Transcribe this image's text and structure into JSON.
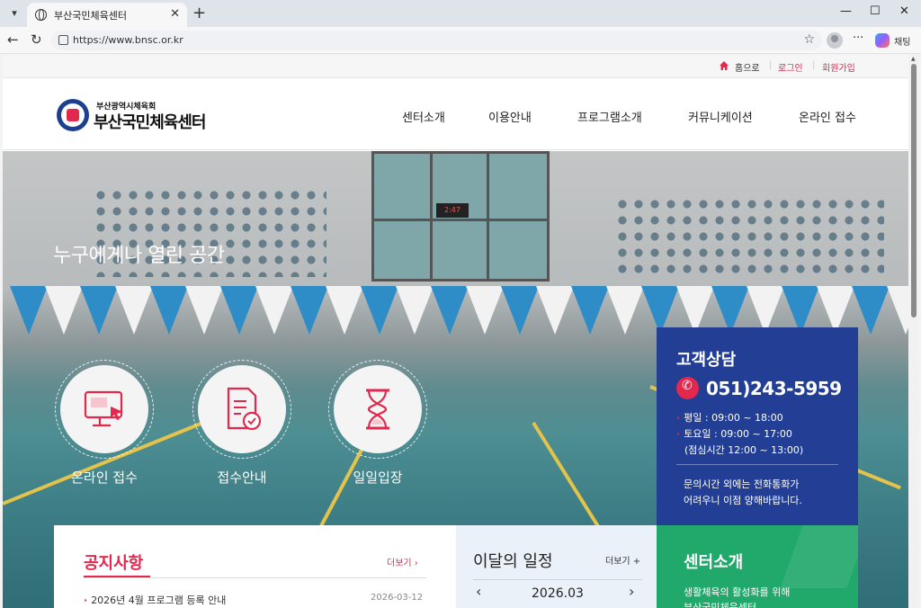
{
  "browser": {
    "tab_title": "부산국민체육센터",
    "url": "https://www.bnsc.or.kr",
    "chat_label": "채팅"
  },
  "util": {
    "home": "홈으로",
    "login": "로그인",
    "join": "회원가입"
  },
  "logo": {
    "sub": "부산광역시체육회",
    "main": "부산국민체육센터"
  },
  "gnb": [
    "센터소개",
    "이용안내",
    "프로그램소개",
    "커뮤니케이션",
    "온라인 접수"
  ],
  "hero": {
    "slogan": "누구에게나 열린 공간",
    "clock": "2:47"
  },
  "quick": [
    {
      "label": "온라인 접수",
      "icon": "monitor-click-icon"
    },
    {
      "label": "접수안내",
      "icon": "document-check-icon"
    },
    {
      "label": "일일입장",
      "icon": "hourglass-icon"
    }
  ],
  "cs": {
    "title": "고객상담",
    "number": "051)243-5959",
    "weekday": "평일 : 09:00 ~ 18:00",
    "saturday": "토요일 : 09:00 ~ 17:00",
    "lunch": "(점심시간 12:00 ~ 13:00)",
    "note1": "문의시간 외에는 전화통화가",
    "note2": "어려우니 이점 양해바랍니다."
  },
  "notice": {
    "title": "공지사항",
    "more": "더보기 ›",
    "item": "2026년 4월 프로그램 등록 안내",
    "date": "2026-03-12"
  },
  "schedule": {
    "title": "이달의 일정",
    "more": "더보기 +",
    "month": "2026.03"
  },
  "center": {
    "title": "센터소개",
    "desc1": "생활체육의 활성화를 위해",
    "desc2": "부산국민체육센터"
  },
  "colors": {
    "accent": "#e3284e",
    "navy": "#223f95",
    "green": "#21a86b"
  }
}
